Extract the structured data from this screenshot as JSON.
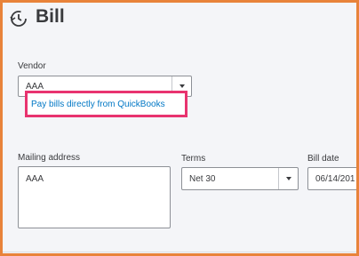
{
  "header": {
    "title": "Bill",
    "icon": "history-clock-icon"
  },
  "vendor": {
    "label": "Vendor",
    "value": "AAA",
    "pay_link": "Pay bills directly from QuickBooks"
  },
  "mailing": {
    "label": "Mailing address",
    "value": "AAA"
  },
  "terms": {
    "label": "Terms",
    "value": "Net 30"
  },
  "bill_date": {
    "label": "Bill date",
    "value": "06/14/201"
  },
  "colors": {
    "frame": "#e8833a",
    "highlight": "#e8336f",
    "link": "#0077c5"
  }
}
